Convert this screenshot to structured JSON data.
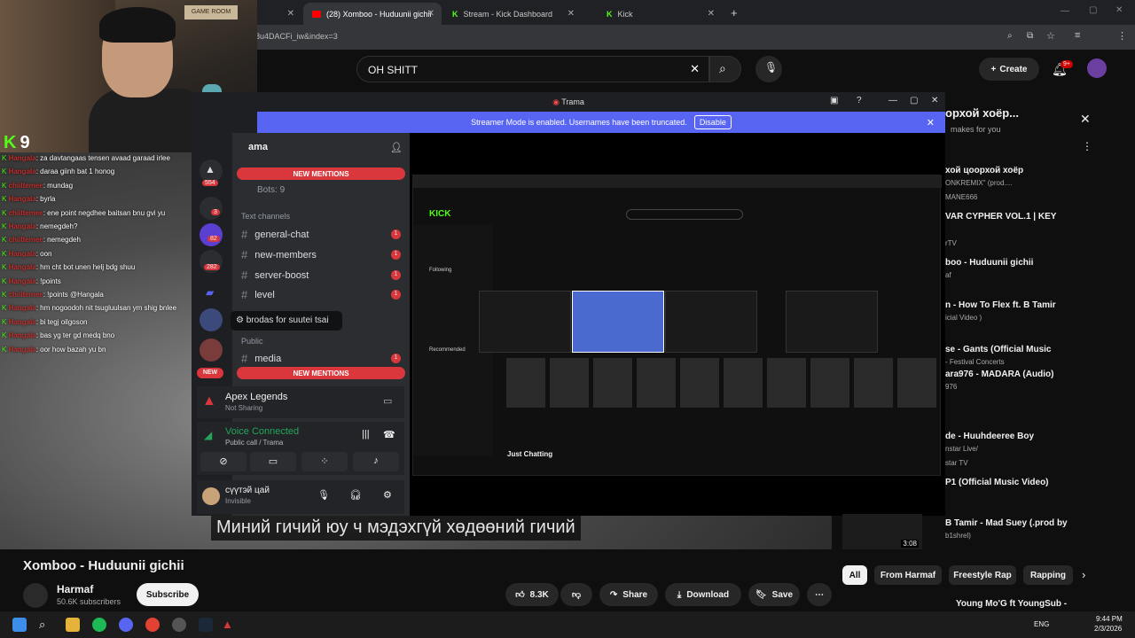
{
  "browser": {
    "tabs": [
      {
        "label": "(28) Xomboo - Huduunii gichii",
        "active": true
      },
      {
        "label": "Stream - Kick Dashboard",
        "active": false
      },
      {
        "label": "Kick",
        "active": false
      }
    ],
    "url": "8u4DACFi_iw&index=3"
  },
  "youtube": {
    "search_value": "OH SHITT",
    "create_label": "Create",
    "notif_count": "9+",
    "video_title": "Xomboo - Huduunii gichii",
    "channel_name": "Harmaf",
    "subscribers": "50.6K subscribers",
    "subscribe_label": "Subscribe",
    "likes": "8.3K",
    "share_label": "Share",
    "download_label": "Download",
    "save_label": "Save",
    "subtitle": "Миний гичий юу ч мэдэхгүй хөдөөний гичий",
    "chips": [
      "All",
      "From Harmaf",
      "Freestyle Rap",
      "Rapping"
    ],
    "panel_title": "орхой хоёр...",
    "panel_sub": "makes for you",
    "sidebar": [
      {
        "title": "хой цоорхой хоёр",
        "sub": "ONKREMIX\" (prod...."
      },
      {
        "title": "",
        "sub": "MANE666"
      },
      {
        "title": "VAR CYPHER VOL.1 | KEY",
        "sub": ""
      },
      {
        "title": "",
        "sub": "rTV"
      },
      {
        "title": "boo - Huduunii gichii",
        "sub": "af"
      },
      {
        "title": "n - How To Flex ft. B Tamir",
        "sub": "icial Video )"
      },
      {
        "title": "se - Gants (Official Music",
        "sub": "- Festival Concerts"
      },
      {
        "title": "ara976 - MADARA (Audio)",
        "sub": "976"
      },
      {
        "title": "de - Huuhdeeree Boy",
        "sub": "nstar Live/"
      },
      {
        "title": "",
        "sub": "star TV"
      },
      {
        "title": "P1 (Official Music Video)",
        "sub": ""
      },
      {
        "title": "B Tamir - Mad Suey (.prod by",
        "sub": "b1shrel)"
      },
      {
        "title": "Young Mo'G ft YoungSub -",
        "sub": ""
      }
    ],
    "thumb_duration": "3:08"
  },
  "stream": {
    "kick_logo": "K",
    "viewers": "9",
    "cam_poster": "GAME ROOM",
    "chat": [
      {
        "user": "Hangala",
        "msg": ": za davtangaas tensen avaad garaad irlee"
      },
      {
        "user": "Hangala",
        "msg": ": daraa giinh bat 1 honog"
      },
      {
        "user": "chiiltemee",
        "msg": ": mundag"
      },
      {
        "user": "Hangala",
        "msg": ": byrla"
      },
      {
        "user": "chiiltemee",
        "msg": ": ene point negdhee baitsan bnu gvi yu"
      },
      {
        "user": "Hangala",
        "msg": ": nemegdeh?"
      },
      {
        "user": "chiiltemee",
        "msg": ": nemegdeh"
      },
      {
        "user": "Hangala",
        "msg": ": oon"
      },
      {
        "user": "Hangala",
        "msg": ": hm cht bot unen helj bdg shuu"
      },
      {
        "user": "Hangala",
        "msg": ": !points"
      },
      {
        "user": "chiiltemee",
        "msg": ": !points @Hangala"
      },
      {
        "user": "Hangala",
        "msg": ": hm nogoodoh nit tsugluulsan ym shig bnlee"
      },
      {
        "user": "Hangala",
        "msg": ": bi tegj oilgoson"
      },
      {
        "user": "Hangala",
        "msg": ": bas yg ter gd medq bno"
      },
      {
        "user": "Hangala",
        "msg": ": oor how bazah yu bn"
      }
    ]
  },
  "discord": {
    "window_title": "Trama",
    "banner_text": "Streamer Mode is enabled. Usernames have been truncated.",
    "banner_button": "Disable",
    "server_name": "ama",
    "new_mentions": "NEW MENTIONS",
    "bots": "Bots: 9",
    "text_channels": "Text channels",
    "channels": [
      "general-chat",
      "new-members",
      "server-boost",
      "level",
      "media"
    ],
    "public_label": "Public",
    "tooltip": "brodas for suutei tsai",
    "guild_badges": [
      "554",
      "82",
      "3",
      "282",
      "NEW"
    ],
    "activity_name": "Apex Legends",
    "activity_sub": "Not Sharing",
    "voice_status": "Voice Connected",
    "voice_sub": "Public call / Trama",
    "username": "сүүтэй цай",
    "user_status": "Invisible",
    "shared_screen_label": "Just Chatting",
    "shared_section_recommended": "Recommended",
    "shared_following": "Following"
  },
  "taskbar": {
    "lang": "ENG",
    "time": "9:44 PM",
    "date": "2/3/2026"
  },
  "colors": {
    "accent_kick": "#53fc18",
    "discord_blurple": "#5865f2",
    "discord_red": "#da373c",
    "youtube_red": "#ff0000"
  }
}
